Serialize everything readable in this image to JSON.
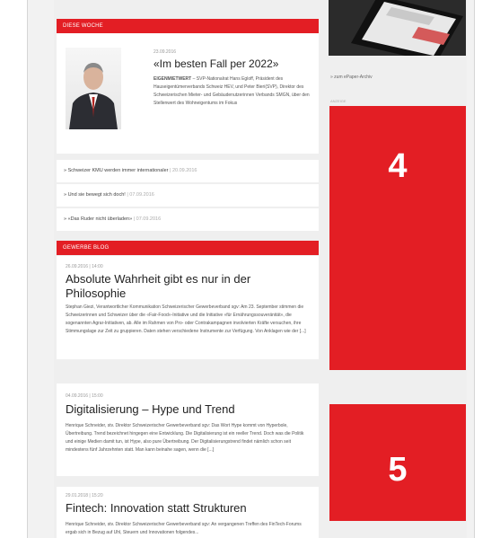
{
  "diese_woche": {
    "header": "DIESE WOCHE",
    "featured": {
      "date": "23.09.2016",
      "title": "«Im besten Fall per 2022»",
      "text_lead": "EIGENMIETWERT",
      "text": "– SVP-Nationalrat Hans Egloff, Präsident des Hauseigentümerverbands Schweiz HEV, und Peter Bieri(SVP), Direktor des Schweizerischen Mieter- und Gebäudenutzerinnen Verbands SMGN, über den Stellenwert des Wohneigentums im Fokus"
    },
    "links": [
      {
        "label": "» Schweizer KMU werden immer internationaler",
        "date": "| 20.09.2016"
      },
      {
        "label": "» Und sie bewegt sich doch!",
        "date": "| 07.09.2016"
      },
      {
        "label": "» «Das Ruder nicht überladen»",
        "date": "| 07.09.2016"
      }
    ]
  },
  "gewerbe_blog": {
    "header": "GEWERBE BLOG",
    "posts": [
      {
        "date": "26.09.2016 | 14:00",
        "title": "Absolute Wahrheit gibt es nur in der Philosophie",
        "text": "Stephan Giezi, Verantwortlicher Kommunikation Schweizerischer Gewerbeverband sgv: Am 23. September stimmen die Schweizerinnen und Schweizer über die «Fair-Food»-Initiative und die Initiative «für Ernährungssouveränität», die sogenannten Agrar-Initiativen, ab. Alle im Rahmen von Pro- oder Contrakampagnen involvierten Kräfte versuchen, ihre Stimmungslage zur Zeit zu gruppieren. Daten stehen verschiedene Instrumente zur Verfügung. Von Anklagen wie der [...]"
      },
      {
        "date": "04.09.2016 | 15:00",
        "title": "Digitalisierung – Hype und Trend",
        "text": "Henrique Schneider, stv. Direktor Schweizerischer Gewerbeverband sgv: Das Wort Hype kommt von Hyperbole, Übertreibung. Trend bezeichnet hingegen eine Entwicklung. Die Digitalisierung ist ein reeller Trend. Doch was die Politik und einige Medien damit tun, ist Hype, also pure Übertreibung. Der Digitalisierungstrend findet nämlich schon seit mindestens fünf Jahrzehnten statt. Man kann beinahe sagen, wenn die [...]"
      },
      {
        "date": "29.01.2018 | 15:20",
        "title": "Fintech: Innovation statt Strukturen",
        "text": "Henrique Schneider, stv. Direktor Schweizerischer Gewerbeverband sgv: An vergangenen Treffen des FinTech-Forums ergab sich in Bezug auf Uhl, Steuern und Innovationen folgendes..."
      }
    ]
  },
  "sidebar": {
    "epaper_caption": "» zum ePaper-Archiv",
    "anzeige_label": "ANZEIGE",
    "ad_1_label": "4",
    "ad_2_label": "5"
  },
  "colors": {
    "accent_red": "#e31e24"
  }
}
